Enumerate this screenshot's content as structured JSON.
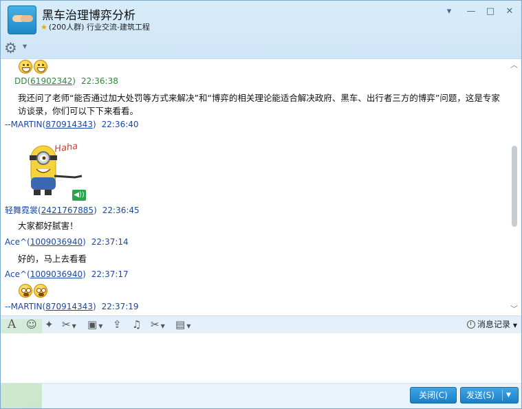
{
  "window": {
    "title": "黑车治理博弈分析",
    "group_size": "(200人群)",
    "group_category": "行业交流-建筑工程"
  },
  "chat": {
    "messages": [
      {
        "sender": "DD",
        "uin": "61902342",
        "time": "22:36:38",
        "text": "我还问了老师“能否通过加大处罚等方式来解决”和“博弈的相关理论能适合解决政府、黑车、出行者三方的博弈”问题，这是专家访谈录，你们可以下下来看看。"
      },
      {
        "sender": "--MARTIN",
        "uin": "870914343",
        "time": "22:36:40",
        "sticker_text": "Haha"
      },
      {
        "sender": "轻舞霓裳",
        "uin": "2421767885",
        "time": "22:36:45",
        "text": "大家都好腻害！"
      },
      {
        "sender": "Ace^",
        "uin": "1009036940",
        "time": "22:37:14",
        "text": "好的，马上去看看"
      },
      {
        "sender": "Ace^",
        "uin": "1009036940",
        "time": "22:37:17"
      },
      {
        "sender": "--MARTIN",
        "uin": "870914343",
        "time": "22:37:19"
      }
    ]
  },
  "toolbar": {
    "history_label": "消息记录"
  },
  "buttons": {
    "close_label": "关闭(C)",
    "send_label": "发送(S)"
  }
}
